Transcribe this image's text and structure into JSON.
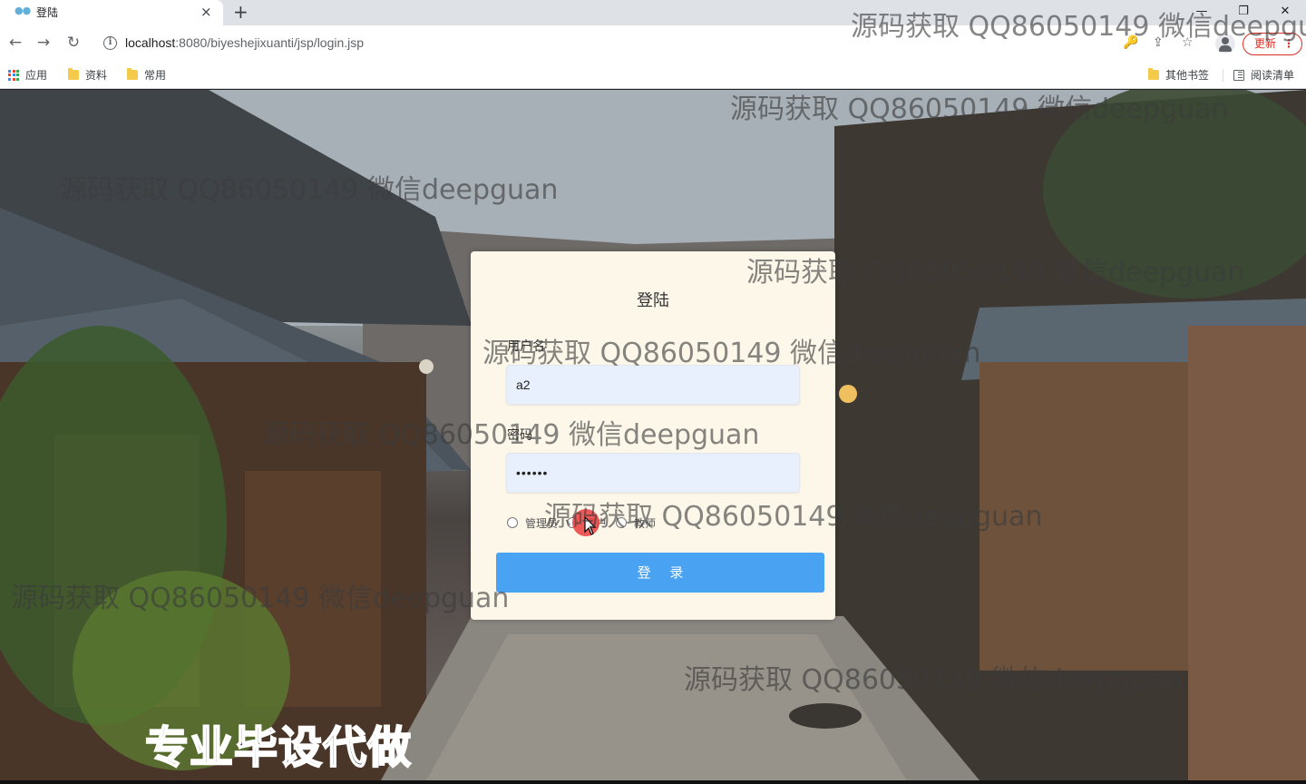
{
  "browser": {
    "tab_title": "登陆",
    "new_tab": "+",
    "tab_close": "×",
    "url_host": "localhost",
    "url_path": ":8080/biyeshejixuanti/jsp/login.jsp",
    "update_label": "更新",
    "update_menu": "⋮",
    "window_controls": [
      "—",
      "❐",
      "✕"
    ],
    "nav": {
      "back": "←",
      "forward": "→",
      "reload": "↻"
    },
    "omni_icons": {
      "key": "🔑",
      "share": "⇪",
      "star": "☆"
    },
    "bookmarks": {
      "apps": "应用",
      "folder1": "资料",
      "folder2": "常用",
      "other": "其他书签",
      "reading_list": "阅读清单"
    }
  },
  "login": {
    "title": "登陆",
    "username_label": "用户名",
    "username_value": "a2",
    "password_label": "密码",
    "password_value": "••••••",
    "roles": [
      "管理员",
      "用户",
      "教师"
    ],
    "submit_label": "登 录"
  },
  "overlay": {
    "watermark_text": "源码获取 QQ86050149 微信deepguan",
    "promo_text": "专业毕设代做"
  },
  "colors": {
    "card_bg": "#fdf7ea",
    "input_bg": "#e8f0fe",
    "button_bg": "#4aa2f3",
    "update_accent": "#d93025"
  }
}
